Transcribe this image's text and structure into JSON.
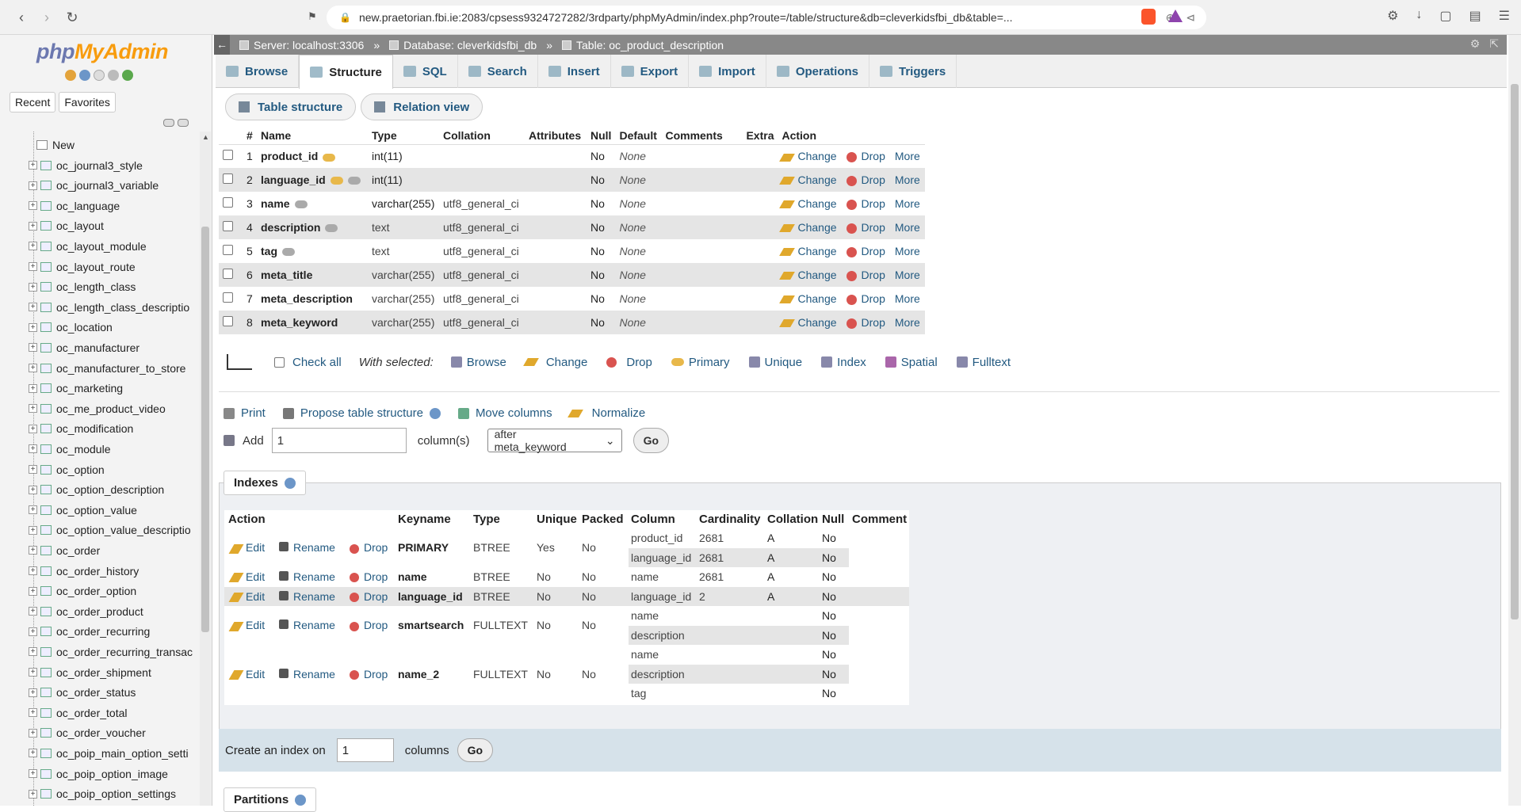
{
  "browser": {
    "url": "new.praetorian.fbi.ie:2083/cpsess9324727282/3rdparty/phpMyAdmin/index.php?route=/table/structure&db=cleverkidsfbi_db&table=..."
  },
  "sidebar": {
    "logo_php": "php",
    "logo_myadmin": "MyAdmin",
    "tabs": [
      "Recent",
      "Favorites"
    ],
    "new_label": "New",
    "tables": [
      "oc_journal3_style",
      "oc_journal3_variable",
      "oc_language",
      "oc_layout",
      "oc_layout_module",
      "oc_layout_route",
      "oc_length_class",
      "oc_length_class_descriptio",
      "oc_location",
      "oc_manufacturer",
      "oc_manufacturer_to_store",
      "oc_marketing",
      "oc_me_product_video",
      "oc_modification",
      "oc_module",
      "oc_option",
      "oc_option_description",
      "oc_option_value",
      "oc_option_value_descriptio",
      "oc_order",
      "oc_order_history",
      "oc_order_option",
      "oc_order_product",
      "oc_order_recurring",
      "oc_order_recurring_transac",
      "oc_order_shipment",
      "oc_order_status",
      "oc_order_total",
      "oc_order_voucher",
      "oc_poip_main_option_setti",
      "oc_poip_option_image",
      "oc_poip_option_settings"
    ]
  },
  "breadcrumb": {
    "server": "Server: localhost:3306",
    "database": "Database: cleverkidsfbi_db",
    "table": "Table: oc_product_description"
  },
  "tabs": [
    "Browse",
    "Structure",
    "SQL",
    "Search",
    "Insert",
    "Export",
    "Import",
    "Operations",
    "Triggers"
  ],
  "subtabs": {
    "structure": "Table structure",
    "relation": "Relation view"
  },
  "structure": {
    "headers": [
      "#",
      "Name",
      "Type",
      "Collation",
      "Attributes",
      "Null",
      "Default",
      "Comments",
      "Extra",
      "Action"
    ],
    "rows": [
      {
        "n": "1",
        "name": "product_id",
        "type": "int(11)",
        "collation": "",
        "null": "No",
        "default": "None"
      },
      {
        "n": "2",
        "name": "language_id",
        "type": "int(11)",
        "collation": "",
        "null": "No",
        "default": "None"
      },
      {
        "n": "3",
        "name": "name",
        "type": "varchar(255)",
        "collation": "utf8_general_ci",
        "null": "No",
        "default": "None"
      },
      {
        "n": "4",
        "name": "description",
        "type": "text",
        "collation": "utf8_general_ci",
        "null": "No",
        "default": "None"
      },
      {
        "n": "5",
        "name": "tag",
        "type": "text",
        "collation": "utf8_general_ci",
        "null": "No",
        "default": "None"
      },
      {
        "n": "6",
        "name": "meta_title",
        "type": "varchar(255)",
        "collation": "utf8_general_ci",
        "null": "No",
        "default": "None"
      },
      {
        "n": "7",
        "name": "meta_description",
        "type": "varchar(255)",
        "collation": "utf8_general_ci",
        "null": "No",
        "default": "None"
      },
      {
        "n": "8",
        "name": "meta_keyword",
        "type": "varchar(255)",
        "collation": "utf8_general_ci",
        "null": "No",
        "default": "None"
      }
    ],
    "actions": {
      "change": "Change",
      "drop": "Drop",
      "more": "More"
    }
  },
  "with_selected": {
    "check_all": "Check all",
    "label": "With selected:",
    "actions": [
      "Browse",
      "Change",
      "Drop",
      "Primary",
      "Unique",
      "Index",
      "Spatial",
      "Fulltext"
    ]
  },
  "tools": {
    "print": "Print",
    "propose": "Propose table structure",
    "move": "Move columns",
    "normalize": "Normalize"
  },
  "add": {
    "label": "Add",
    "value": "1",
    "columns_label": "column(s)",
    "position": "after meta_keyword",
    "go": "Go"
  },
  "indexes": {
    "title": "Indexes",
    "headers": [
      "Action",
      "Keyname",
      "Type",
      "Unique",
      "Packed",
      "Column",
      "Cardinality",
      "Collation",
      "Null",
      "Comment"
    ],
    "action_labels": {
      "edit": "Edit",
      "rename": "Rename",
      "drop": "Drop"
    },
    "rows": [
      {
        "keyname": "PRIMARY",
        "type": "BTREE",
        "unique": "Yes",
        "packed": "No",
        "cols": [
          {
            "c": "product_id",
            "card": "2681",
            "coll": "A",
            "null": "No"
          },
          {
            "c": "language_id",
            "card": "2681",
            "coll": "A",
            "null": "No"
          }
        ]
      },
      {
        "keyname": "name",
        "type": "BTREE",
        "unique": "No",
        "packed": "No",
        "cols": [
          {
            "c": "name",
            "card": "2681",
            "coll": "A",
            "null": "No"
          }
        ]
      },
      {
        "keyname": "language_id",
        "type": "BTREE",
        "unique": "No",
        "packed": "No",
        "cols": [
          {
            "c": "language_id",
            "card": "2",
            "coll": "A",
            "null": "No"
          }
        ]
      },
      {
        "keyname": "smartsearch",
        "type": "FULLTEXT",
        "unique": "No",
        "packed": "No",
        "cols": [
          {
            "c": "name",
            "card": "",
            "coll": "",
            "null": "No"
          },
          {
            "c": "description",
            "card": "",
            "coll": "",
            "null": "No"
          }
        ]
      },
      {
        "keyname": "name_2",
        "type": "FULLTEXT",
        "unique": "No",
        "packed": "No",
        "cols": [
          {
            "c": "name",
            "card": "",
            "coll": "",
            "null": "No"
          },
          {
            "c": "description",
            "card": "",
            "coll": "",
            "null": "No"
          },
          {
            "c": "tag",
            "card": "",
            "coll": "",
            "null": "No"
          }
        ]
      }
    ],
    "create_label": "Create an index on",
    "create_value": "1",
    "create_columns": "columns",
    "go": "Go"
  },
  "partitions": {
    "title": "Partitions"
  }
}
